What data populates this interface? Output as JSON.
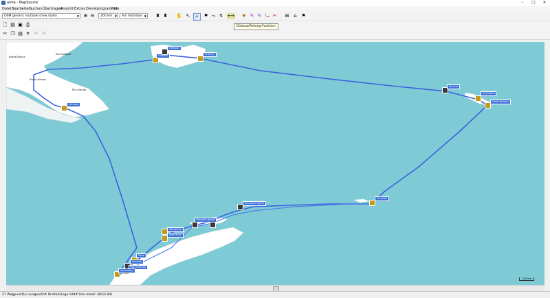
{
  "window": {
    "title": "antla - MapSource"
  },
  "menu": [
    "Datei",
    "Bearbeiten",
    "Suchen",
    "Übertragen",
    "Ansicht",
    "Extras",
    "Dienstprogramme",
    "Hilfe"
  ],
  "toolbar": {
    "map_product": "OSM generic routable (new style)",
    "zoom_level": "200 km",
    "detail_level": "Am höchsten",
    "tooltip": "Distanz/Peilung-Funktion"
  },
  "map": {
    "places": [
      {
        "name": "Bahia Blanca"
      },
      {
        "name": "Rio Gallegos"
      },
      {
        "name": "Punta Arenas"
      },
      {
        "name": "Rio Grande"
      }
    ],
    "waypoints": [
      {
        "label": "Ushuaia"
      },
      {
        "label": "Stanley"
      },
      {
        "label": "Carcass"
      },
      {
        "label": "Harbour"
      },
      {
        "label": "Elsehul"
      },
      {
        "label": "Grytviken"
      },
      {
        "label": "Gold Harbour"
      },
      {
        "label": "Orcadas"
      },
      {
        "label": "Elephant Island"
      },
      {
        "label": "Penguin Island"
      },
      {
        "label": "Deception"
      },
      {
        "label": "Half Moon"
      },
      {
        "label": "Neko"
      },
      {
        "label": "Lemaire"
      },
      {
        "label": "Port Lockroy"
      },
      {
        "label": "Vernadsky"
      }
    ],
    "scale_label": "200 km"
  },
  "statusbar": {
    "selection": "27 Wegpunkt(e) ausgewählt",
    "coords": "Breite/Länge hddd°mm.mmm' (WGS 84)"
  },
  "colors": {
    "sea": "#7ecbd5",
    "land": "#ffffff",
    "track": "#3a62e0",
    "label": "#3c6fd8"
  }
}
